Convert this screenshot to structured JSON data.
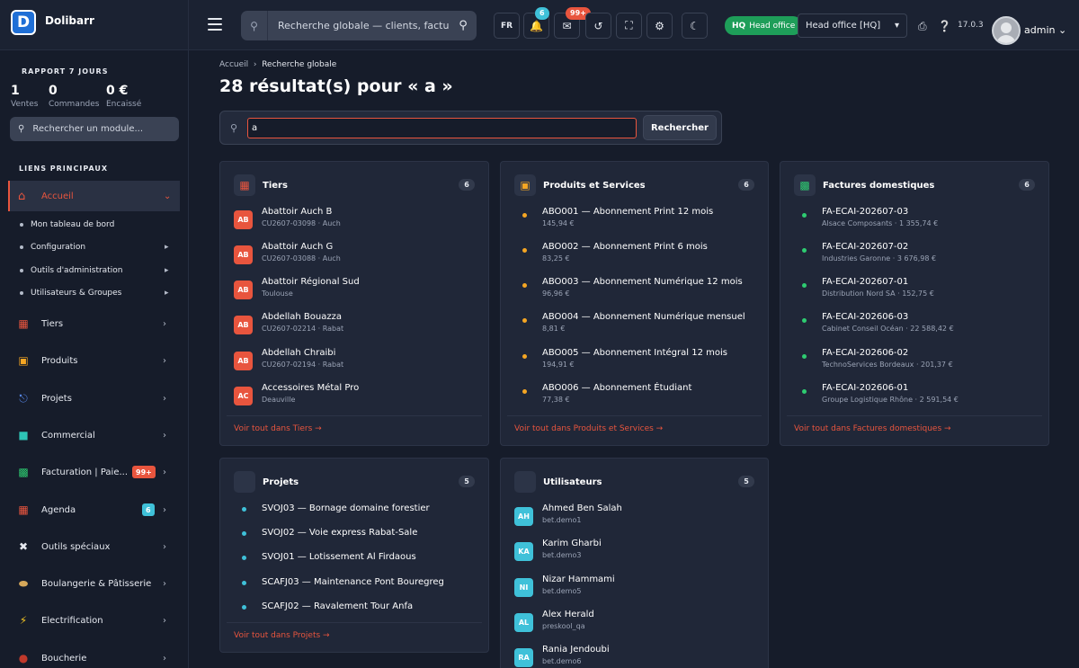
{
  "app": {
    "name": "Dolibarr",
    "logo_letter": "D",
    "version": "17.0.3",
    "user": "admin",
    "language": "FR"
  },
  "topbar": {
    "search_placeholder": "Recherche globale — clients, factures",
    "notif_badge": "6",
    "mail_badge": "99+",
    "entity_tag_short": "HQ",
    "entity_tag_label": "Head office",
    "entity_select": "Head office [HQ]"
  },
  "sidebar": {
    "report_title": "RAPPORT 7 JOURS",
    "stats": [
      {
        "value": "1",
        "label": "Ventes"
      },
      {
        "value": "0",
        "label": "Commandes"
      },
      {
        "value": "0 €",
        "label": "Encaissé"
      }
    ],
    "module_search": "Rechercher un module...",
    "section_title": "LIENS PRINCIPAUX",
    "home": "Accueil",
    "home_sub": [
      "Mon tableau de bord",
      "Configuration",
      "Outils d'administration",
      "Utilisateurs & Groupes"
    ],
    "items": [
      {
        "label": "Tiers",
        "icon": "building-icon"
      },
      {
        "label": "Produits",
        "icon": "box-icon"
      },
      {
        "label": "Projets",
        "icon": "project-icon"
      },
      {
        "label": "Commercial",
        "icon": "briefcase-icon"
      },
      {
        "label": "Facturation | Paie...",
        "icon": "invoice-icon",
        "badge": "99+"
      },
      {
        "label": "Agenda",
        "icon": "calendar-icon",
        "badge": "6"
      },
      {
        "label": "Outils spéciaux",
        "icon": "tools-icon"
      },
      {
        "label": "Boulangerie & Pâtisserie",
        "icon": "bread-icon"
      },
      {
        "label": "Electrification",
        "icon": "bolt-icon"
      },
      {
        "label": "Boucherie",
        "icon": "meat-icon"
      }
    ]
  },
  "main": {
    "breadcrumb": [
      "Accueil",
      "Recherche globale"
    ],
    "title": "28 résultat(s) pour « a »",
    "query": "a",
    "search_button": "Rechercher",
    "cards": {
      "tiers": {
        "title": "Tiers",
        "count": "6",
        "footer": "Voir tout dans Tiers →",
        "rows": [
          {
            "av": "AB",
            "name": "Abattoir Auch B",
            "sub": "CU2607-03098 · Auch"
          },
          {
            "av": "AB",
            "name": "Abattoir Auch G",
            "sub": "CU2607-03088 · Auch"
          },
          {
            "av": "AB",
            "name": "Abattoir Régional Sud",
            "sub": "Toulouse"
          },
          {
            "av": "AB",
            "name": "Abdellah Bouazza",
            "sub": "CU2607-02214 · Rabat"
          },
          {
            "av": "AB",
            "name": "Abdellah Chraibi",
            "sub": "CU2607-02194 · Rabat"
          },
          {
            "av": "AC",
            "name": "Accessoires Métal Pro",
            "sub": "Deauville"
          }
        ]
      },
      "produits": {
        "title": "Produits et Services",
        "count": "6",
        "footer": "Voir tout dans Produits et Services →",
        "rows": [
          {
            "name": "ABO001 — Abonnement Print 12 mois",
            "sub": "145,94 €"
          },
          {
            "name": "ABO002 — Abonnement Print 6 mois",
            "sub": "83,25 €"
          },
          {
            "name": "ABO003 — Abonnement Numérique 12 mois",
            "sub": "96,96 €"
          },
          {
            "name": "ABO004 — Abonnement Numérique mensuel",
            "sub": "8,81 €"
          },
          {
            "name": "ABO005 — Abonnement Intégral 12 mois",
            "sub": "194,91 €"
          },
          {
            "name": "ABO006 — Abonnement Étudiant",
            "sub": "77,38 €"
          }
        ]
      },
      "factures": {
        "title": "Factures domestiques",
        "count": "6",
        "footer": "Voir tout dans Factures domestiques →",
        "rows": [
          {
            "name": "FA-ECAI-202607-03",
            "sub": "Alsace Composants · 1 355,74 €"
          },
          {
            "name": "FA-ECAI-202607-02",
            "sub": "Industries Garonne · 3 676,98 €"
          },
          {
            "name": "FA-ECAI-202607-01",
            "sub": "Distribution Nord SA · 152,75 €"
          },
          {
            "name": "FA-ECAI-202606-03",
            "sub": "Cabinet Conseil Océan · 22 588,42 €"
          },
          {
            "name": "FA-ECAI-202606-02",
            "sub": "TechnoServices Bordeaux · 201,37 €"
          },
          {
            "name": "FA-ECAI-202606-01",
            "sub": "Groupe Logistique Rhône · 2 591,54 €"
          }
        ]
      },
      "projets": {
        "title": "Projets",
        "count": "5",
        "footer": "Voir tout dans Projets →",
        "rows": [
          {
            "name": "SVOJ03 — Bornage domaine forestier"
          },
          {
            "name": "SVOJ02 — Voie express Rabat-Sale"
          },
          {
            "name": "SVOJ01 — Lotissement Al Firdaous"
          },
          {
            "name": "SCAFJ03 — Maintenance Pont Bouregreg"
          },
          {
            "name": "SCAFJ02 — Ravalement Tour Anfa"
          }
        ]
      },
      "utilisateurs": {
        "title": "Utilisateurs",
        "count": "5",
        "rows": [
          {
            "av": "AH",
            "name": "Ahmed Ben Salah",
            "sub": "bet.demo1"
          },
          {
            "av": "KA",
            "name": "Karim Gharbi",
            "sub": "bet.demo3"
          },
          {
            "av": "NI",
            "name": "Nizar Hammami",
            "sub": "bet.demo5"
          },
          {
            "av": "AL",
            "name": "Alex Herald",
            "sub": "preskool_qa"
          },
          {
            "av": "RA",
            "name": "Rania Jendoubi",
            "sub": "bet.demo6"
          }
        ]
      }
    }
  },
  "colors": {
    "accent": "#e8553e",
    "tiers_avatar": "#e8553e",
    "product_dot": "#f5a623",
    "invoice_dot": "#2ecc71",
    "project_dot": "#3fc1d9",
    "user_avatar": "#3fc1d9",
    "badge_red": "#e8553e",
    "badge_cyan": "#3fc1d9",
    "hq_green": "#1e9e59"
  }
}
